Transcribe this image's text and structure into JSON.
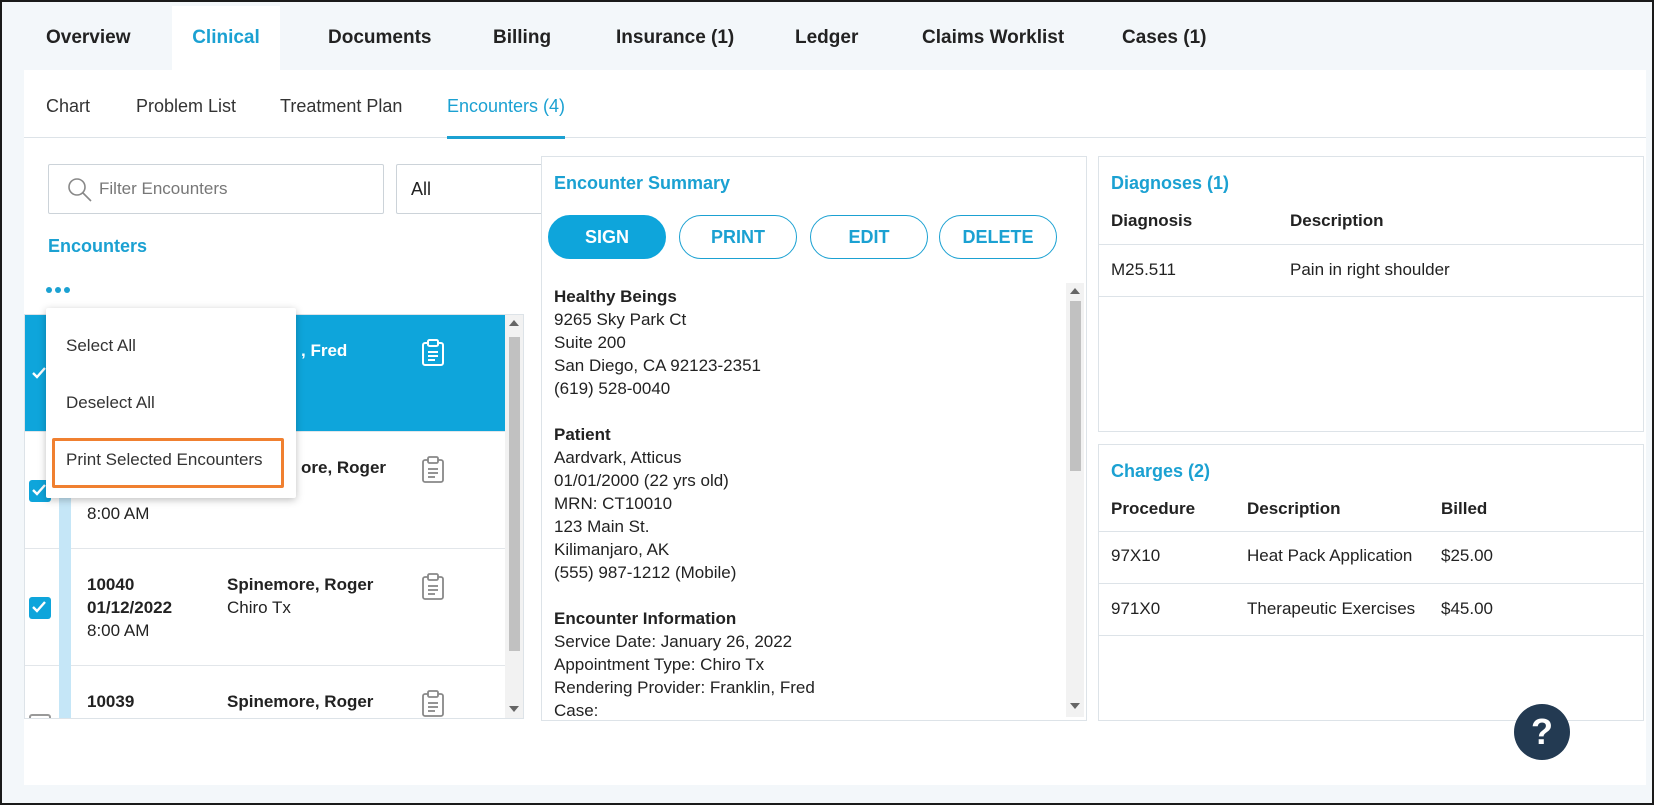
{
  "top_tabs": [
    "Overview",
    "Clinical",
    "Documents",
    "Billing",
    "Insurance (1)",
    "Ledger",
    "Claims Worklist",
    "Cases (1)"
  ],
  "sub_tabs": [
    "Chart",
    "Problem List",
    "Treatment Plan",
    "Encounters (4)"
  ],
  "filter": {
    "placeholder": "Filter Encounters",
    "value": ""
  },
  "select": {
    "value": "All"
  },
  "encounters_heading": "Encounters",
  "dropdown": {
    "items": [
      "Select All",
      "Deselect All",
      "Print Selected Encounters"
    ]
  },
  "encounter_rows": [
    {
      "id": "",
      "date": "",
      "time": "",
      "provider": ", Fred",
      "type": "",
      "checked": true,
      "selected": true
    },
    {
      "id": "",
      "date": "",
      "time": "8:00 AM",
      "provider": "ore, Roger",
      "type": "",
      "checked": true,
      "selected": false
    },
    {
      "id": "10040",
      "date": "01/12/2022",
      "time": "8:00 AM",
      "provider": "Spinemore, Roger",
      "type": "Chiro Tx",
      "checked": true,
      "selected": false
    },
    {
      "id": "10039",
      "date": "",
      "time": "",
      "provider": "Spinemore, Roger",
      "type": "",
      "checked": false,
      "selected": false
    }
  ],
  "summary": {
    "title": "Encounter Summary",
    "buttons": {
      "sign": "SIGN",
      "print": "PRINT",
      "edit": "EDIT",
      "delete": "DELETE"
    },
    "facility": {
      "heading": "Healthy Beings",
      "lines": [
        "9265 Sky Park Ct",
        "Suite 200",
        "San Diego, CA 92123-2351",
        "(619) 528-0040"
      ]
    },
    "patient": {
      "heading": "Patient",
      "lines": [
        "Aardvark, Atticus",
        "01/01/2000 (22 yrs old)",
        "MRN: CT10010",
        "123 Main St.",
        "Kilimanjaro, AK",
        "(555) 987-1212 (Mobile)"
      ]
    },
    "encounter_info": {
      "heading": "Encounter Information",
      "lines": [
        "Service Date: January 26, 2022",
        "Appointment Type: Chiro Tx",
        "Rendering Provider: Franklin, Fred",
        "Case:"
      ]
    }
  },
  "diagnoses": {
    "title": "Diagnoses (1)",
    "headers": [
      "Diagnosis",
      "Description"
    ],
    "rows": [
      [
        "M25.511",
        "Pain in right shoulder"
      ]
    ]
  },
  "charges": {
    "title": "Charges (2)",
    "headers": [
      "Procedure",
      "Description",
      "Billed"
    ],
    "rows": [
      [
        "97X10",
        "Heat Pack Application",
        "$25.00"
      ],
      [
        "971X0",
        "Therapeutic Exercises",
        "$45.00"
      ]
    ]
  },
  "help_label": "?",
  "colors": {
    "accent": "#1ba1d2",
    "selected_row": "#0ea5db",
    "highlight_border": "#f08030",
    "help_bg": "#233a52"
  }
}
